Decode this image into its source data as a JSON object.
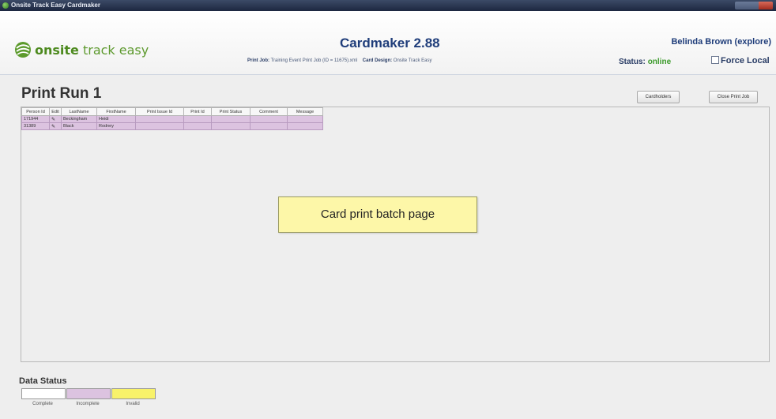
{
  "window": {
    "title": "Onsite Track Easy Cardmaker"
  },
  "header": {
    "logo_text_bold": "onsite",
    "logo_text_rest": " track easy",
    "app_title": "Cardmaker 2.88",
    "print_job_label": "Print Job:",
    "print_job_value": "Training Event Print Job (ID = 11675).xml",
    "card_design_label": "Card Design:",
    "card_design_value": "Onsite Track Easy",
    "user": "Belinda Brown (explore)",
    "status_label": "Status:",
    "status_value": "online",
    "status_color": "#3b9a2a",
    "force_local_label": "Force Local",
    "force_local_checked": false
  },
  "main": {
    "title": "Print Run 1",
    "cardholders_button": "Cardholders",
    "close_print_job_button": "Close Print Job",
    "columns": [
      "Person Id",
      "Edit",
      "LastName",
      "FirstName",
      "Print Issue Id",
      "Print Id",
      "Print Status",
      "Comment",
      "Message"
    ],
    "rows": [
      {
        "person_id": "171944",
        "edit_icon": "pencil-icon",
        "last_name": "Beckingham",
        "first_name": "Heidi",
        "print_issue_id": "",
        "print_id": "",
        "print_status": "",
        "comment": "",
        "message": ""
      },
      {
        "person_id": "31389",
        "edit_icon": "pencil-icon",
        "last_name": "Black",
        "first_name": "Rodney",
        "print_issue_id": "",
        "print_id": "",
        "print_status": "",
        "comment": "",
        "message": ""
      }
    ],
    "callout": "Card print batch page"
  },
  "legend": {
    "title": "Data Status",
    "items": [
      {
        "label": "Complete",
        "color": "#ffffff"
      },
      {
        "label": "Incomplete",
        "color": "#dcc3e0"
      },
      {
        "label": "Invalid",
        "color": "#f8f26a"
      }
    ]
  }
}
